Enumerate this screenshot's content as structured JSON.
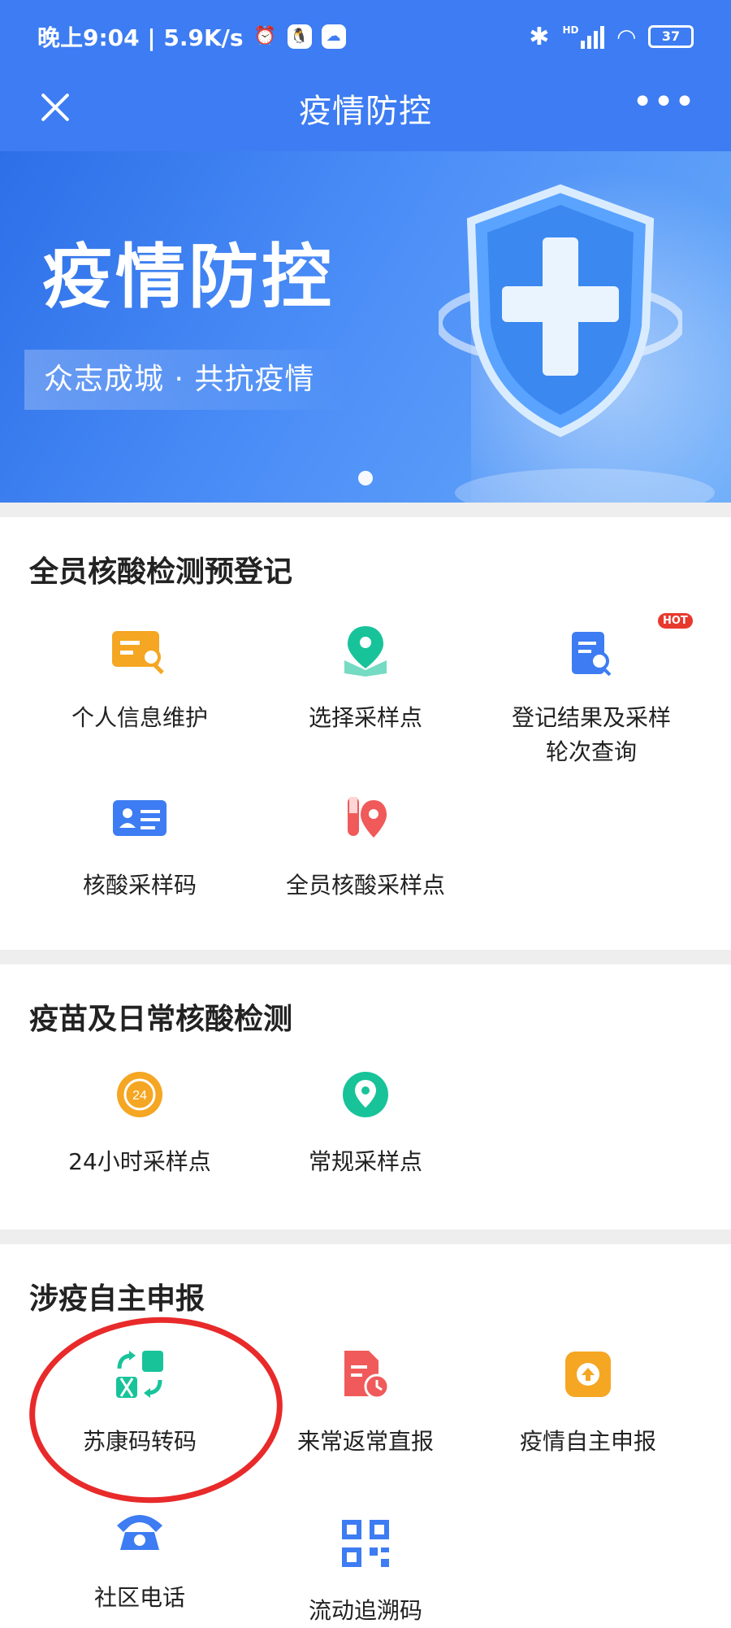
{
  "status_bar": {
    "time_text": "晚上9:04 | 5.9K/s",
    "hd_label": "HD",
    "battery": "37"
  },
  "titlebar": {
    "title": "疫情防控",
    "more": "•••"
  },
  "banner": {
    "headline": "疫情防控",
    "slogan": "众志成城 · 共抗疫情"
  },
  "sections": [
    {
      "title": "全员核酸检测预登记",
      "items": [
        {
          "label": "个人信息维护",
          "icon": "profile-search-icon"
        },
        {
          "label": "选择采样点",
          "icon": "map-pin-icon"
        },
        {
          "label": "登记结果及采样\n轮次查询",
          "icon": "document-search-icon",
          "badge": "HOT"
        },
        {
          "label": "核酸采样码",
          "icon": "id-card-icon"
        },
        {
          "label": "全员核酸采样点",
          "icon": "test-tube-pin-icon"
        }
      ]
    },
    {
      "title": "疫苗及日常核酸检测",
      "items": [
        {
          "label": "24小时采样点",
          "icon": "clock-24-icon",
          "icon_text": "24"
        },
        {
          "label": "常规采样点",
          "icon": "location-pin-icon"
        }
      ]
    },
    {
      "title": "涉疫自主申报",
      "items": [
        {
          "label": "苏康码转码",
          "icon": "code-transfer-icon"
        },
        {
          "label": "来常返常直报",
          "icon": "document-clock-icon"
        },
        {
          "label": "疫情自主申报",
          "icon": "upload-icon"
        },
        {
          "label": "社区电话",
          "icon": "phone-icon"
        },
        {
          "label": "流动追溯码",
          "icon": "qr-code-icon"
        }
      ]
    }
  ],
  "colors": {
    "primary_blue": "#3d7cf2",
    "orange": "#f5a623",
    "teal": "#19c39a",
    "red": "#f05a5a",
    "annotation_red": "#e82a2a"
  }
}
